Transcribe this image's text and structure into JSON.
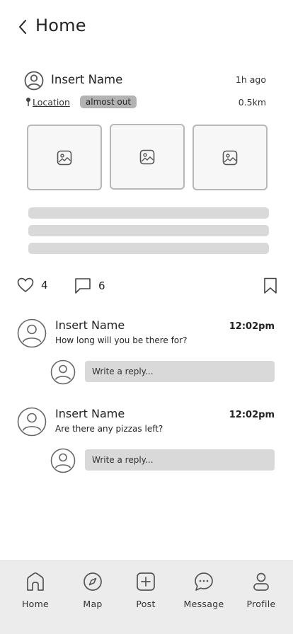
{
  "header": {
    "title": "Home"
  },
  "post": {
    "author": "Insert Name",
    "time_ago": "1h ago",
    "location": "Location",
    "status": "almost out",
    "distance": "0.5km",
    "likes": "4",
    "comments": "6"
  },
  "comments": [
    {
      "author": "Insert Name",
      "time": "12:02pm",
      "text": "How long will you be there for?",
      "reply_placeholder": "Write a reply..."
    },
    {
      "author": "Insert Name",
      "time": "12:02pm",
      "text": "Are there any pizzas left?",
      "reply_placeholder": "Write a reply..."
    }
  ],
  "tabbar": {
    "items": [
      {
        "label": "Home",
        "icon": "home-icon"
      },
      {
        "label": "Map",
        "icon": "compass-icon"
      },
      {
        "label": "Post",
        "icon": "plus-square-icon"
      },
      {
        "label": "Message",
        "icon": "chat-bubble-icon"
      },
      {
        "label": "Profile",
        "icon": "person-icon"
      }
    ]
  },
  "colors": {
    "skeleton": "#d9d9d9",
    "badge": "#b3b3b3",
    "tabbar": "#ececec",
    "icon_stroke": "#555555"
  }
}
